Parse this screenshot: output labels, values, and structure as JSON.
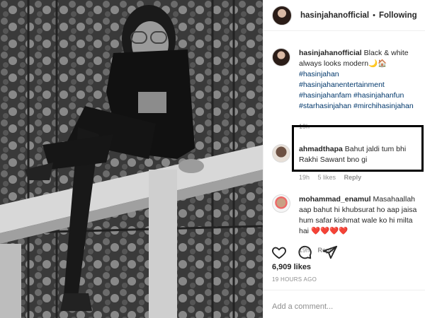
{
  "post": {
    "username": "hasinjahanofficial",
    "follow_status": "Following",
    "separator": "•"
  },
  "caption": {
    "username": "hasinjahanofficial",
    "text": "Black & white always looks modern🌙🏠",
    "hashtags": [
      "#hasinjahan",
      "#hasinjahanentertainment",
      "#hasinjahanfam #hasinjahanfun",
      "#starhasinjahan #mirchihasinjahan"
    ],
    "time": "19h"
  },
  "comments": [
    {
      "username": "ahmadthapa",
      "text": "Bahut jaldi tum bhi Rakhi Sawant bno gi",
      "time": "19h",
      "likes": "5 likes",
      "reply": "Reply"
    },
    {
      "username": "mohammad_enamul",
      "text": "Masahaallah aap bahut hi khubsurat ho aap jaisa hum safar kishmat wale ko hi milta hai",
      "hearts": "❤️❤️❤️❤️",
      "time": "19h",
      "reply": "Reply"
    }
  ],
  "likes_count": "6,909 likes",
  "timestamp": "19 HOURS AGO",
  "add_comment": {
    "placeholder": "Add a comment..."
  },
  "icons": [
    "heart-icon",
    "comment-icon",
    "share-icon"
  ]
}
